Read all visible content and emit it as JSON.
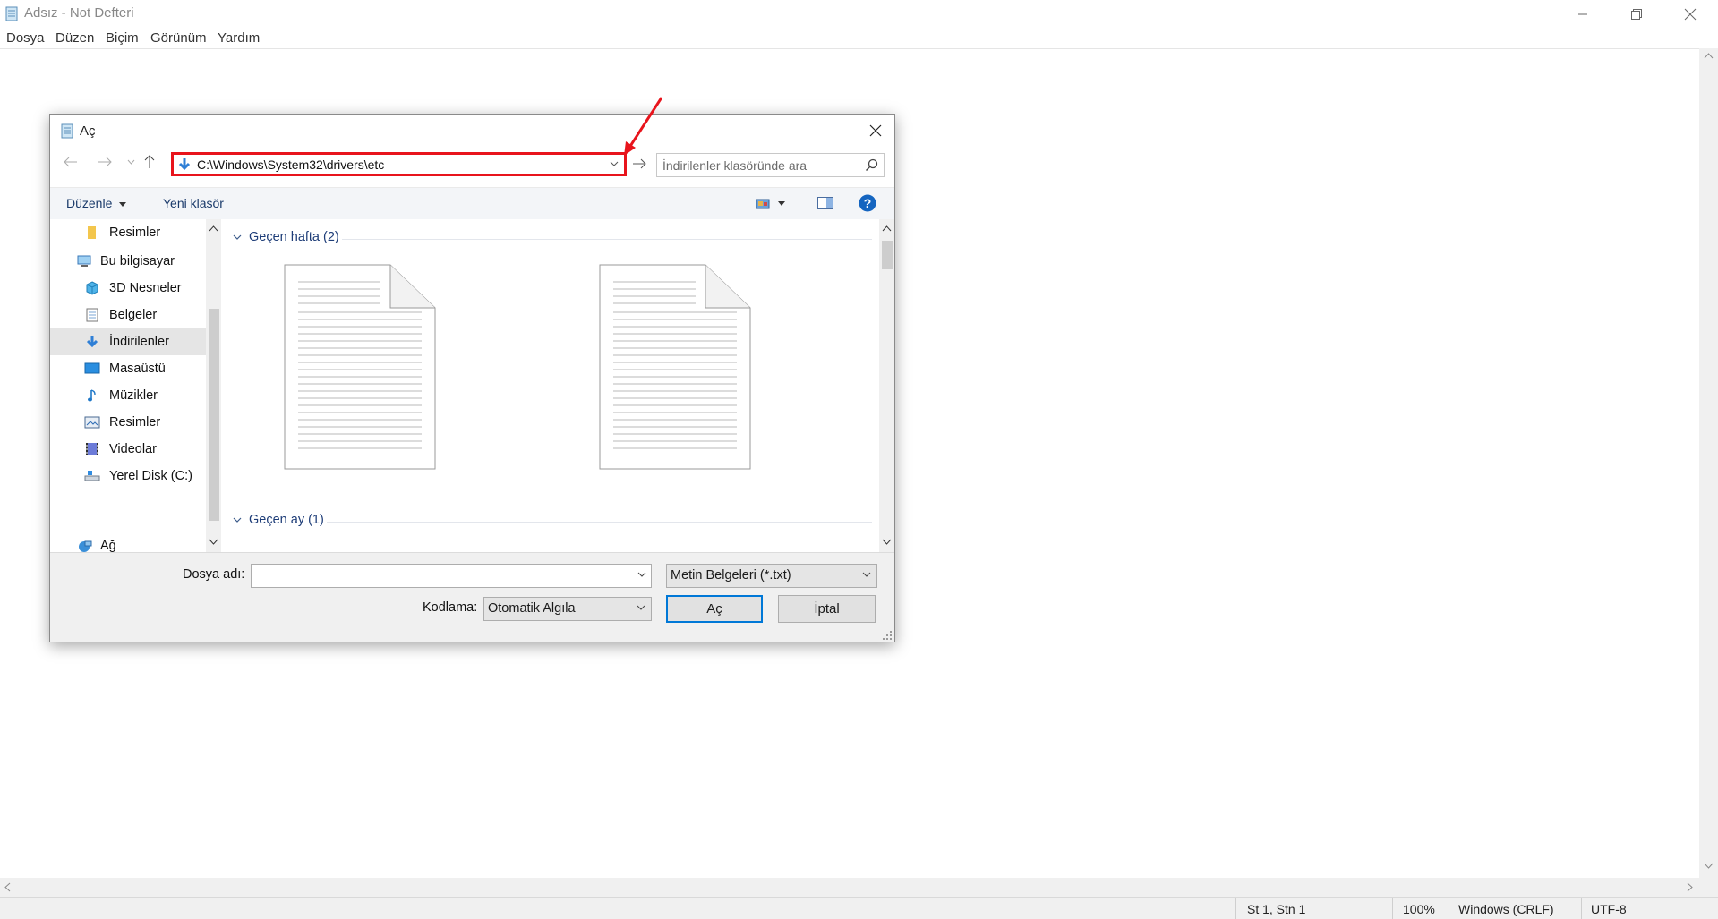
{
  "notepad": {
    "title": "Adsız - Not Defteri",
    "menu": [
      "Dosya",
      "Düzen",
      "Biçim",
      "Görünüm",
      "Yardım"
    ],
    "status": {
      "position": "St 1, Stn 1",
      "zoom": "100%",
      "line_ending": "Windows (CRLF)",
      "encoding": "UTF-8"
    }
  },
  "dialog": {
    "title": "Aç",
    "address": "C:\\Windows\\System32\\drivers\\etc",
    "search_placeholder": "İndirilenler klasöründe ara",
    "toolbar": {
      "organize": "Düzenle",
      "new_folder": "Yeni klasör"
    },
    "nav_items": [
      {
        "label": "Resimler",
        "icon": "folder-icon"
      },
      {
        "label": "Bu bilgisayar",
        "icon": "computer-icon"
      },
      {
        "label": "3D Nesneler",
        "icon": "3d-objects-icon"
      },
      {
        "label": "Belgeler",
        "icon": "documents-icon"
      },
      {
        "label": "İndirilenler",
        "icon": "downloads-icon",
        "selected": true
      },
      {
        "label": "Masaüstü",
        "icon": "desktop-icon"
      },
      {
        "label": "Müzikler",
        "icon": "music-icon"
      },
      {
        "label": "Resimler",
        "icon": "pictures-icon"
      },
      {
        "label": "Videolar",
        "icon": "videos-icon"
      },
      {
        "label": "Yerel Disk (C:)",
        "icon": "local-disk-icon"
      },
      {
        "label": "Ağ",
        "icon": "network-icon"
      }
    ],
    "groups": [
      {
        "label": "Geçen hafta (2)"
      },
      {
        "label": "Geçen ay (1)"
      }
    ],
    "filename_label": "Dosya adı:",
    "filename_value": "",
    "filetype": "Metin Belgeleri (*.txt)",
    "encoding_label": "Kodlama:",
    "encoding_value": "Otomatik Algıla",
    "open_button": "Aç",
    "cancel_button": "İptal"
  },
  "colors": {
    "highlight": "#e8141c",
    "accent": "#0078d7"
  }
}
